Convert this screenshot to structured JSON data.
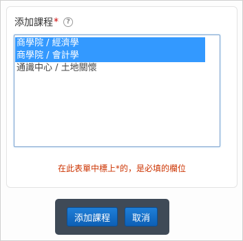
{
  "field": {
    "label": "添加課程",
    "required_mark": "*",
    "help_icon": "?"
  },
  "listbox": {
    "options": [
      {
        "label": "商學院 / 經濟學",
        "selected": true
      },
      {
        "label": "商學院 / 會計學",
        "selected": true
      },
      {
        "label": "通識中心 / 土地關懷",
        "selected": false
      }
    ]
  },
  "form_note": "在此表單中標上*的，是必填的欄位",
  "buttons": {
    "add_label": "添加課程",
    "cancel_label": "取消"
  },
  "colors": {
    "selected_bg": "#3399ff",
    "button_bar_bg": "#3f4a57",
    "note_color": "#cc3300"
  }
}
